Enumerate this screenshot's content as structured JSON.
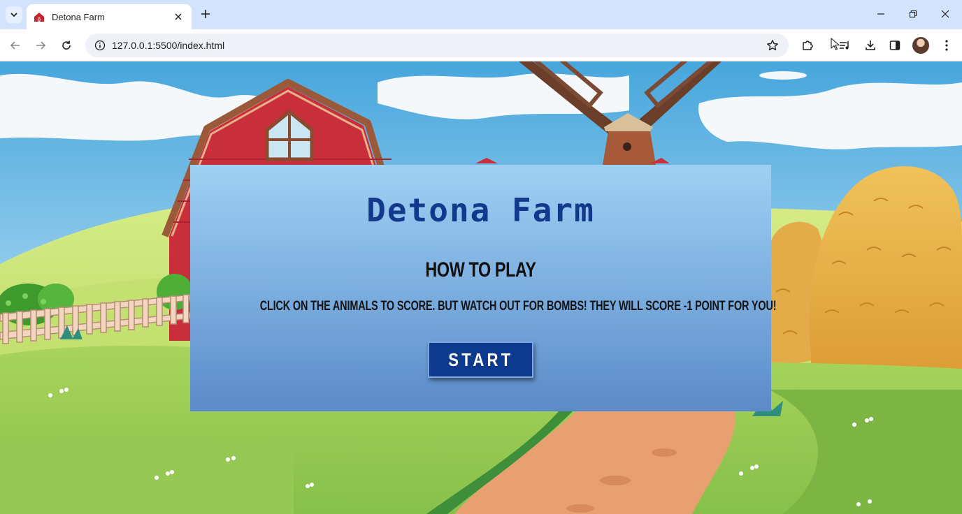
{
  "browser": {
    "tab_title": "Detona Farm",
    "url": "127.0.0.1:5500/index.html"
  },
  "icons": {
    "tab_search": "chevron-down-icon",
    "favicon": "barn-icon",
    "tab_close": "close-icon",
    "new_tab": "plus-icon",
    "back": "arrow-left-icon",
    "forward": "arrow-right-icon",
    "reload": "reload-icon",
    "site_info": "info-icon",
    "bookmark": "star-icon",
    "extensions": "puzzle-icon",
    "media": "media-controls-icon",
    "downloads": "download-icon",
    "side_panel": "side-panel-icon",
    "menu": "kebab-menu-icon"
  },
  "game": {
    "title": "Detona Farm",
    "howto_heading": "HOW TO PLAY",
    "instructions": "CLICK ON THE ANIMALS TO SCORE. BUT WATCH OUT FOR BOMBS! THEY WILL SCORE -1 POINT FOR YOU!",
    "start_label": "START"
  },
  "colors": {
    "title": "#12398c",
    "start_button": "#0d3a8c",
    "panel_top": "#9fd0f3",
    "panel_bottom": "#5b8ac8"
  }
}
